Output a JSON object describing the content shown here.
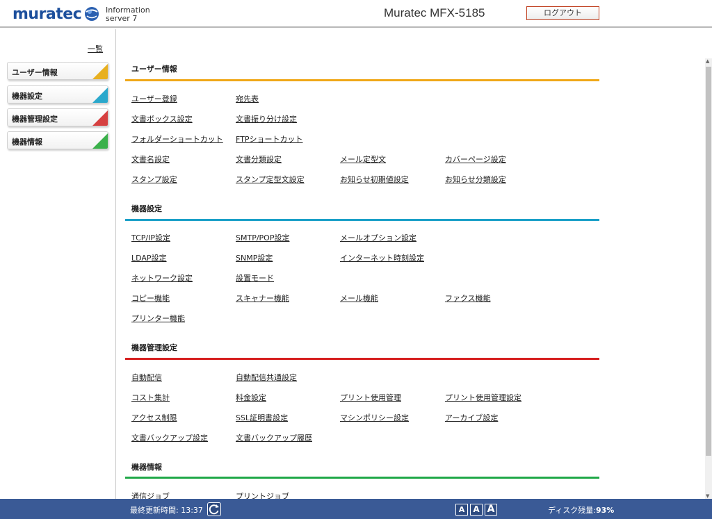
{
  "header": {
    "brand": "muratec",
    "info_line1": "Information",
    "info_line2": "server 7",
    "device_name": "Muratec MFX-5185",
    "logout_label": "ログアウト"
  },
  "sidebar": {
    "list_link": "一覧",
    "items": [
      {
        "label": "ユーザー情報",
        "color": "#e8b020"
      },
      {
        "label": "機器設定",
        "color": "#2aa8cc"
      },
      {
        "label": "機器管理設定",
        "color": "#d64040"
      },
      {
        "label": "機器情報",
        "color": "#3ab04a"
      }
    ]
  },
  "sections": [
    {
      "title": "ユーザー情報",
      "color": "#f0a818",
      "rows": [
        [
          "ユーザー登録",
          "宛先表"
        ],
        [
          "文書ボックス設定",
          "文書振り分け設定"
        ],
        [
          "フォルダーショートカット",
          "FTPショートカット"
        ],
        [
          "文書名設定",
          "文書分類設定",
          "メール定型文",
          "カバーページ設定"
        ],
        [
          "スタンプ設定",
          "スタンプ定型文設定",
          "お知らせ初期値設定",
          "お知らせ分類設定"
        ]
      ]
    },
    {
      "title": "機器設定",
      "color": "#1aa0c8",
      "rows": [
        [
          "TCP/IP設定",
          "SMTP/POP設定",
          "メールオプション設定"
        ],
        [
          "LDAP設定",
          "SNMP設定",
          "インターネット時刻設定"
        ],
        [
          "ネットワーク設定",
          "設置モード"
        ],
        [
          "コピー機能",
          "スキャナー機能",
          "メール機能",
          "ファクス機能"
        ],
        [
          "プリンター機能"
        ]
      ]
    },
    {
      "title": "機器管理設定",
      "color": "#d62020",
      "rows": [
        [
          "自動配信",
          "自動配信共通設定"
        ],
        [
          "コスト集計",
          "料金設定",
          "プリント使用管理",
          "プリント使用管理設定"
        ],
        [
          "アクセス制限",
          "SSL証明書設定",
          "マシンポリシー設定",
          "アーカイブ設定"
        ],
        [
          "文書バックアップ設定",
          "文書バックアップ履歴"
        ]
      ]
    },
    {
      "title": "機器情報",
      "color": "#20a848",
      "rows": [
        [
          "通信ジョブ",
          "プリントジョブ"
        ]
      ]
    }
  ],
  "footer": {
    "last_updated_label": "最終更新時間",
    "last_updated_time": "13:37",
    "font_buttons": [
      "A",
      "A",
      "A"
    ],
    "disk_label": "ディスク残量",
    "disk_value": "93%"
  },
  "icons": {
    "refresh": "refresh-icon",
    "globe": "globe-icon"
  }
}
